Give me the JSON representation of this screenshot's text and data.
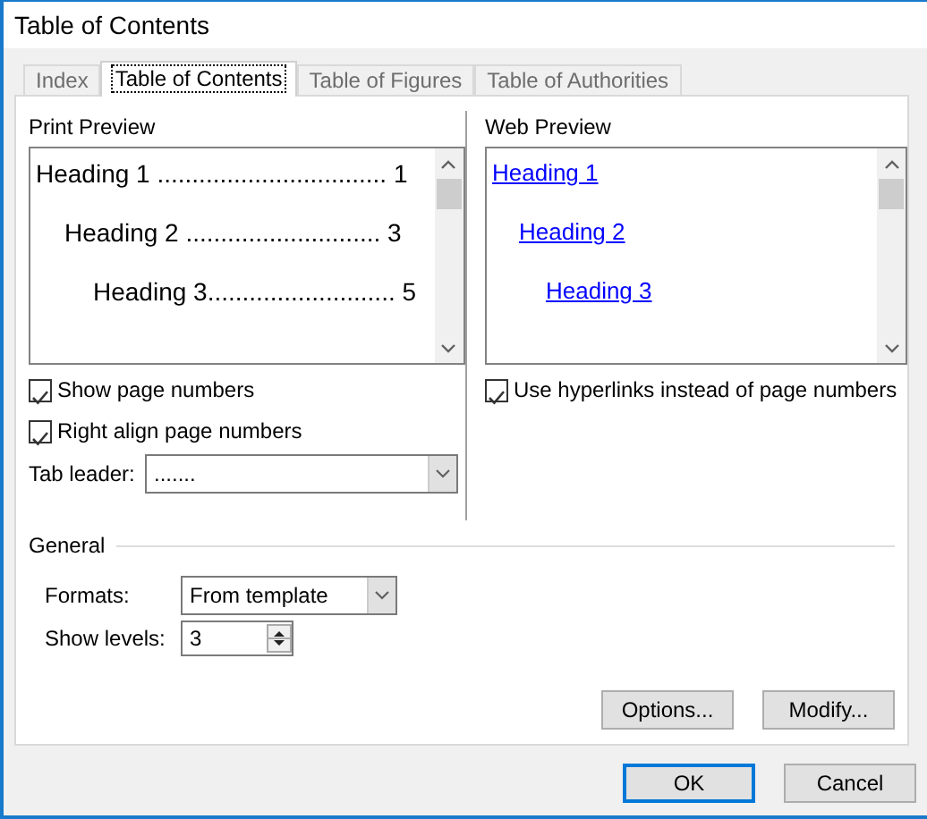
{
  "window": {
    "title": "Table of Contents"
  },
  "tabs": [
    {
      "label": "Index",
      "selected": false
    },
    {
      "label": "Table of Contents",
      "selected": true
    },
    {
      "label": "Table of Figures",
      "selected": false
    },
    {
      "label": "Table of Authorities",
      "selected": false
    }
  ],
  "print_preview": {
    "label": "Print Preview",
    "entries": [
      {
        "text": "Heading 1",
        "leader": " .................................",
        "page": "1"
      },
      {
        "text": "Heading 2",
        "leader": " ............................",
        "page": "3"
      },
      {
        "text": "Heading 3",
        "leader": "...........................",
        "page": "5"
      }
    ]
  },
  "print_options": [
    {
      "label": "Show page numbers",
      "checked": true
    },
    {
      "label": "Right align page numbers",
      "checked": true
    }
  ],
  "tab_leader": {
    "label": "Tab leader:",
    "value": "......."
  },
  "web_preview": {
    "label": "Web Preview",
    "entries": [
      "Heading 1",
      "Heading 2",
      "Heading 3"
    ]
  },
  "web_options": [
    {
      "label": "Use hyperlinks instead of page numbers",
      "checked": true
    }
  ],
  "general": {
    "label": "General",
    "formats": {
      "label": "Formats:",
      "value": "From template"
    },
    "show_levels": {
      "label": "Show levels:",
      "value": "3"
    }
  },
  "panel_buttons": [
    "Options...",
    "Modify..."
  ],
  "dialog_buttons": [
    {
      "label": "OK",
      "default": true
    },
    {
      "label": "Cancel",
      "default": false
    }
  ]
}
